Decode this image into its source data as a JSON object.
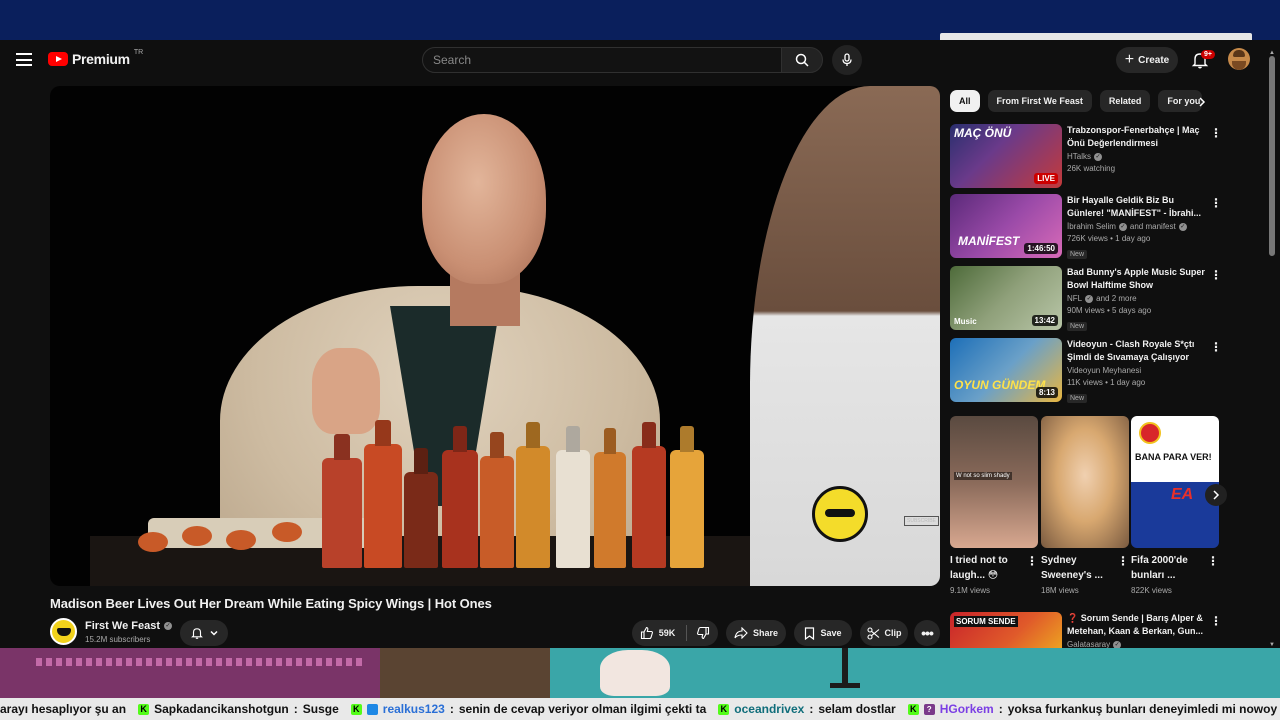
{
  "masthead": {
    "brand": "Premium",
    "country": "TR",
    "search_placeholder": "Search",
    "create_label": "Create",
    "notif_badge": "9+"
  },
  "video": {
    "title": "Madison Beer Lives Out Her Dream While Eating Spicy Wings | Hot Ones",
    "channel": "First We Feast",
    "subscribers": "15.2M subscribers",
    "likes": "59K",
    "share_label": "Share",
    "save_label": "Save",
    "clip_label": "Clip",
    "watermark": "SUBSCRIBE"
  },
  "chips": [
    "All",
    "From First We Feast",
    "Related",
    "For you"
  ],
  "recommendations": [
    {
      "title": "Trabzonspor-Fenerbahçe | Maç Önü Değerlendirmesi",
      "channel": "HTalks",
      "stats": "26K watching",
      "badge": "LIVE",
      "new": "",
      "thumb_a": "#2a2f6e",
      "thumb_b": "#c43a3a"
    },
    {
      "title": "Bir Hayalle Geldik Biz Bu Günlere! \"MANİFEST\" - İbrahi...",
      "channel": "İbrahim Selim",
      "channel_extra": "and manifest",
      "stats": "726K views • 1 day ago",
      "badge": "1:46:50",
      "new": "New",
      "thumb_a": "#5b2a7a",
      "thumb_b": "#d86ab8"
    },
    {
      "title": "Bad Bunny's Apple Music Super Bowl Halftime Show",
      "channel": "NFL",
      "channel_extra": "and 2 more",
      "stats": "90M views • 5 days ago",
      "badge": "13:42",
      "new": "New",
      "thumb_a": "#4e6b3a",
      "thumb_b": "#b9c6a8"
    },
    {
      "title": "Videoyun - Clash Royale S*çtı Şimdi de Sıvamaya Çalışıyor",
      "channel": "Videoyun Meyhanesi",
      "stats": "11K views • 1 day ago",
      "badge": "8:13",
      "new": "New",
      "thumb_a": "#1d6fb8",
      "thumb_b": "#e9b640"
    }
  ],
  "shorts": [
    {
      "title": "I tried not to laugh... 😳",
      "views": "9.1M views",
      "caption": "W not so slim shady",
      "thumb_a": "#5a4a40",
      "thumb_b": "#d8a890"
    },
    {
      "title": "Sydney Sweeney's ...",
      "views": "18M views",
      "caption": "",
      "thumb_a": "#c8a070",
      "thumb_b": "#f0d0b0"
    },
    {
      "title": "Fifa 2000'de bunları ...",
      "views": "822K views",
      "caption": "BANA PARA VER!",
      "thumb_a": "#ffffff",
      "thumb_b": "#1a3a9a"
    }
  ],
  "last_rec": {
    "title": "❓ Sorum Sende | Barış Alper & Metehan, Kaan & Berkan, Gun...",
    "channel": "Galatasaray",
    "thumb_tag": "SORUM SENDE"
  },
  "ticker": [
    {
      "prefix": "arayı hesaplıyor şu an",
      "badges": [],
      "user": "",
      "msg": ""
    },
    {
      "prefix": "",
      "badges": [
        "k"
      ],
      "user": "Sapkadancikanshotgun",
      "msg": "Susge",
      "color": "normal"
    },
    {
      "prefix": "",
      "badges": [
        "k",
        "x"
      ],
      "user": "realkus123",
      "msg": "senin de cevap veriyor olman ilgimi çekti  ta",
      "color": "blue"
    },
    {
      "prefix": "",
      "badges": [
        "k"
      ],
      "user": "oceandrivex",
      "msg": "selam dostlar",
      "color": "teal"
    },
    {
      "prefix": "",
      "badges": [
        "k",
        "q"
      ],
      "user": "HGorkem",
      "msg": "yoksa furkankuş bunları deneyimledi mi nowoy",
      "color": "purple"
    }
  ]
}
